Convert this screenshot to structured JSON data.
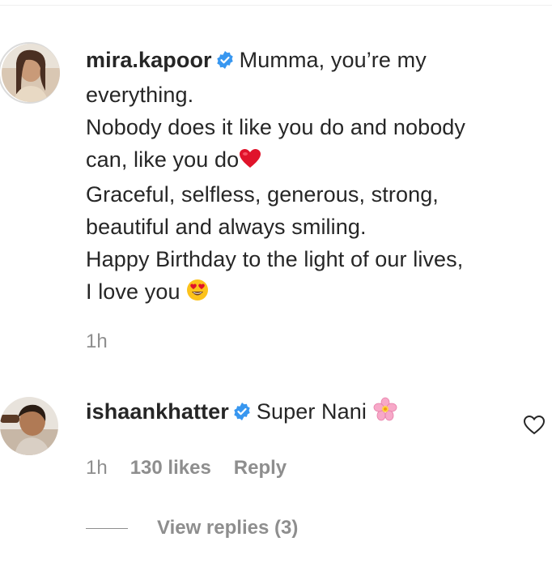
{
  "comments": [
    {
      "username": "mira.kapoor",
      "verified": true,
      "text_lines": [
        "Mumma, you’re my",
        "everything.",
        "Nobody does it like you do and nobody",
        "can, like you do",
        "Graceful, selfless, generous, strong,",
        "beautiful and always smiling.",
        "Happy Birthday to the light of our lives,",
        "I love you "
      ],
      "time": "1h"
    },
    {
      "username": "ishaankhatter",
      "verified": true,
      "text": "Super Nani ",
      "time": "1h",
      "likes": "130 likes",
      "reply_label": "Reply"
    }
  ],
  "view_replies_label": "View replies (3)",
  "icons": {
    "verified": "verified-badge-icon",
    "heart": "red-heart-emoji",
    "heart_eyes": "heart-eyes-emoji",
    "blossom": "cherry-blossom-emoji",
    "like": "heart-outline-icon"
  },
  "colors": {
    "verified_blue": "#3897f0",
    "text": "#262626",
    "muted": "#8e8e8e"
  }
}
